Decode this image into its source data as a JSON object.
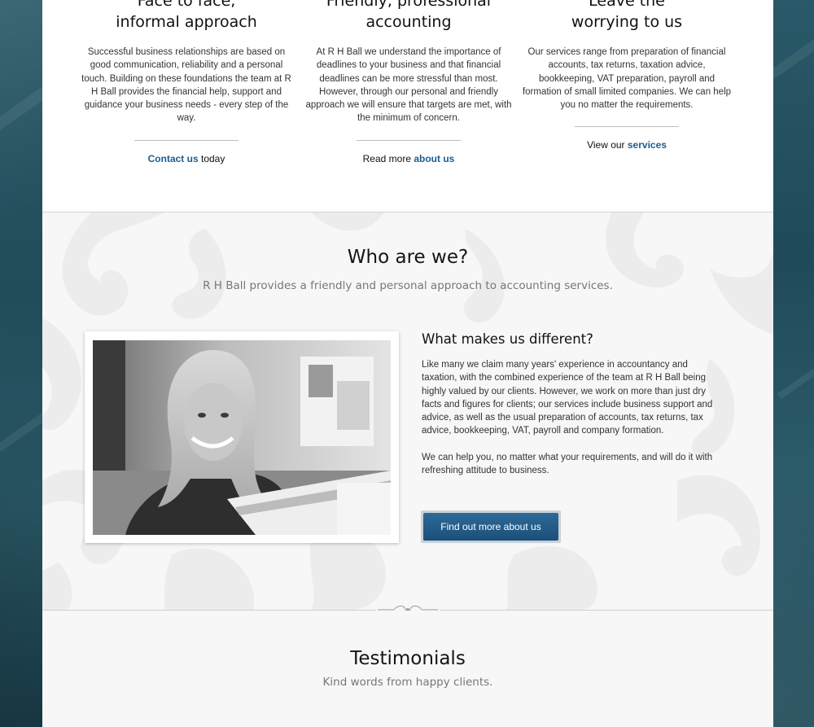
{
  "services": [
    {
      "title_line1": "Face to face,",
      "title_line2": "informal approach",
      "text": "Successful business relationships are based on good communication, reliability and a personal touch. Building on these foundations the team at R H Ball provides the financial help, support and guidance your business needs - every step of the way.",
      "cta_link": "Contact us",
      "cta_after": " today"
    },
    {
      "title_line1": "Friendly, professional",
      "title_line2": "accounting",
      "text": "At R H Ball we understand the importance of deadlines to your business and that financial deadlines can be more stressful than most. However, through our personal and friendly approach we will ensure that targets are met, with the minimum of concern.",
      "cta_before": "Read more ",
      "cta_link": "about us"
    },
    {
      "title_line1": "Leave the",
      "title_line2": "worrying to us",
      "text": "Our services range from preparation of financial accounts, tax returns, taxation advice, bookkeeping, VAT preparation, payroll and formation of small limited companies. We can help you no matter the requirements.",
      "cta_before": "View our ",
      "cta_link": "services"
    }
  ],
  "who": {
    "heading": "Who are we?",
    "subheading": "R H Ball provides a friendly and personal approach to accounting services.",
    "about_heading": "What makes us different?",
    "paragraph1": "Like many we claim many years' experience in accountancy and taxation, with the combined experience of the team at R H Ball being highly valued by our clients. However, we work on more than just dry facts and figures for clients; our services include business support and advice, as well as the usual preparation of accounts, tax returns, tax advice, bookkeeping, VAT, payroll and company formation.",
    "paragraph2": "We can help you, no matter what your requirements, and will do it with refreshing attitude to business.",
    "button_label": "Find out more about us"
  },
  "testimonials": {
    "heading": "Testimonials",
    "subheading": "Kind words from happy clients."
  },
  "colors": {
    "link": "#1c5d8f",
    "button": "#245c89",
    "side_background": "#24505e"
  },
  "icons": {
    "divider_ornament": "scroll-ornament-icon",
    "photo": "smiling-woman-photo"
  }
}
